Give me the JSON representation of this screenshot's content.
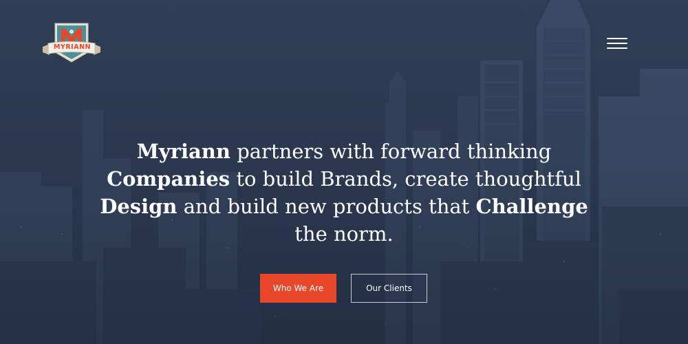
{
  "brand": {
    "logo_text": "MYRIANN",
    "logo_letter": "M"
  },
  "header": {
    "menu_icon": "hamburger-icon"
  },
  "hero": {
    "headline": [
      {
        "text": "Myriann",
        "bold": true
      },
      {
        "text": " partners with forward thinking ",
        "bold": false
      },
      {
        "text": "Companies",
        "bold": true
      },
      {
        "text": " to build Brands, create thoughtful ",
        "bold": false
      },
      {
        "text": "Design",
        "bold": true
      },
      {
        "text": " and build new products that ",
        "bold": false
      },
      {
        "text": "Challenge",
        "bold": true
      },
      {
        "text": " the norm.",
        "bold": false
      }
    ]
  },
  "buttons": {
    "primary_label": "Who We Are",
    "secondary_label": "Our Clients"
  },
  "colors": {
    "accent": "#e8472a",
    "overlay": "#2c3a52"
  }
}
